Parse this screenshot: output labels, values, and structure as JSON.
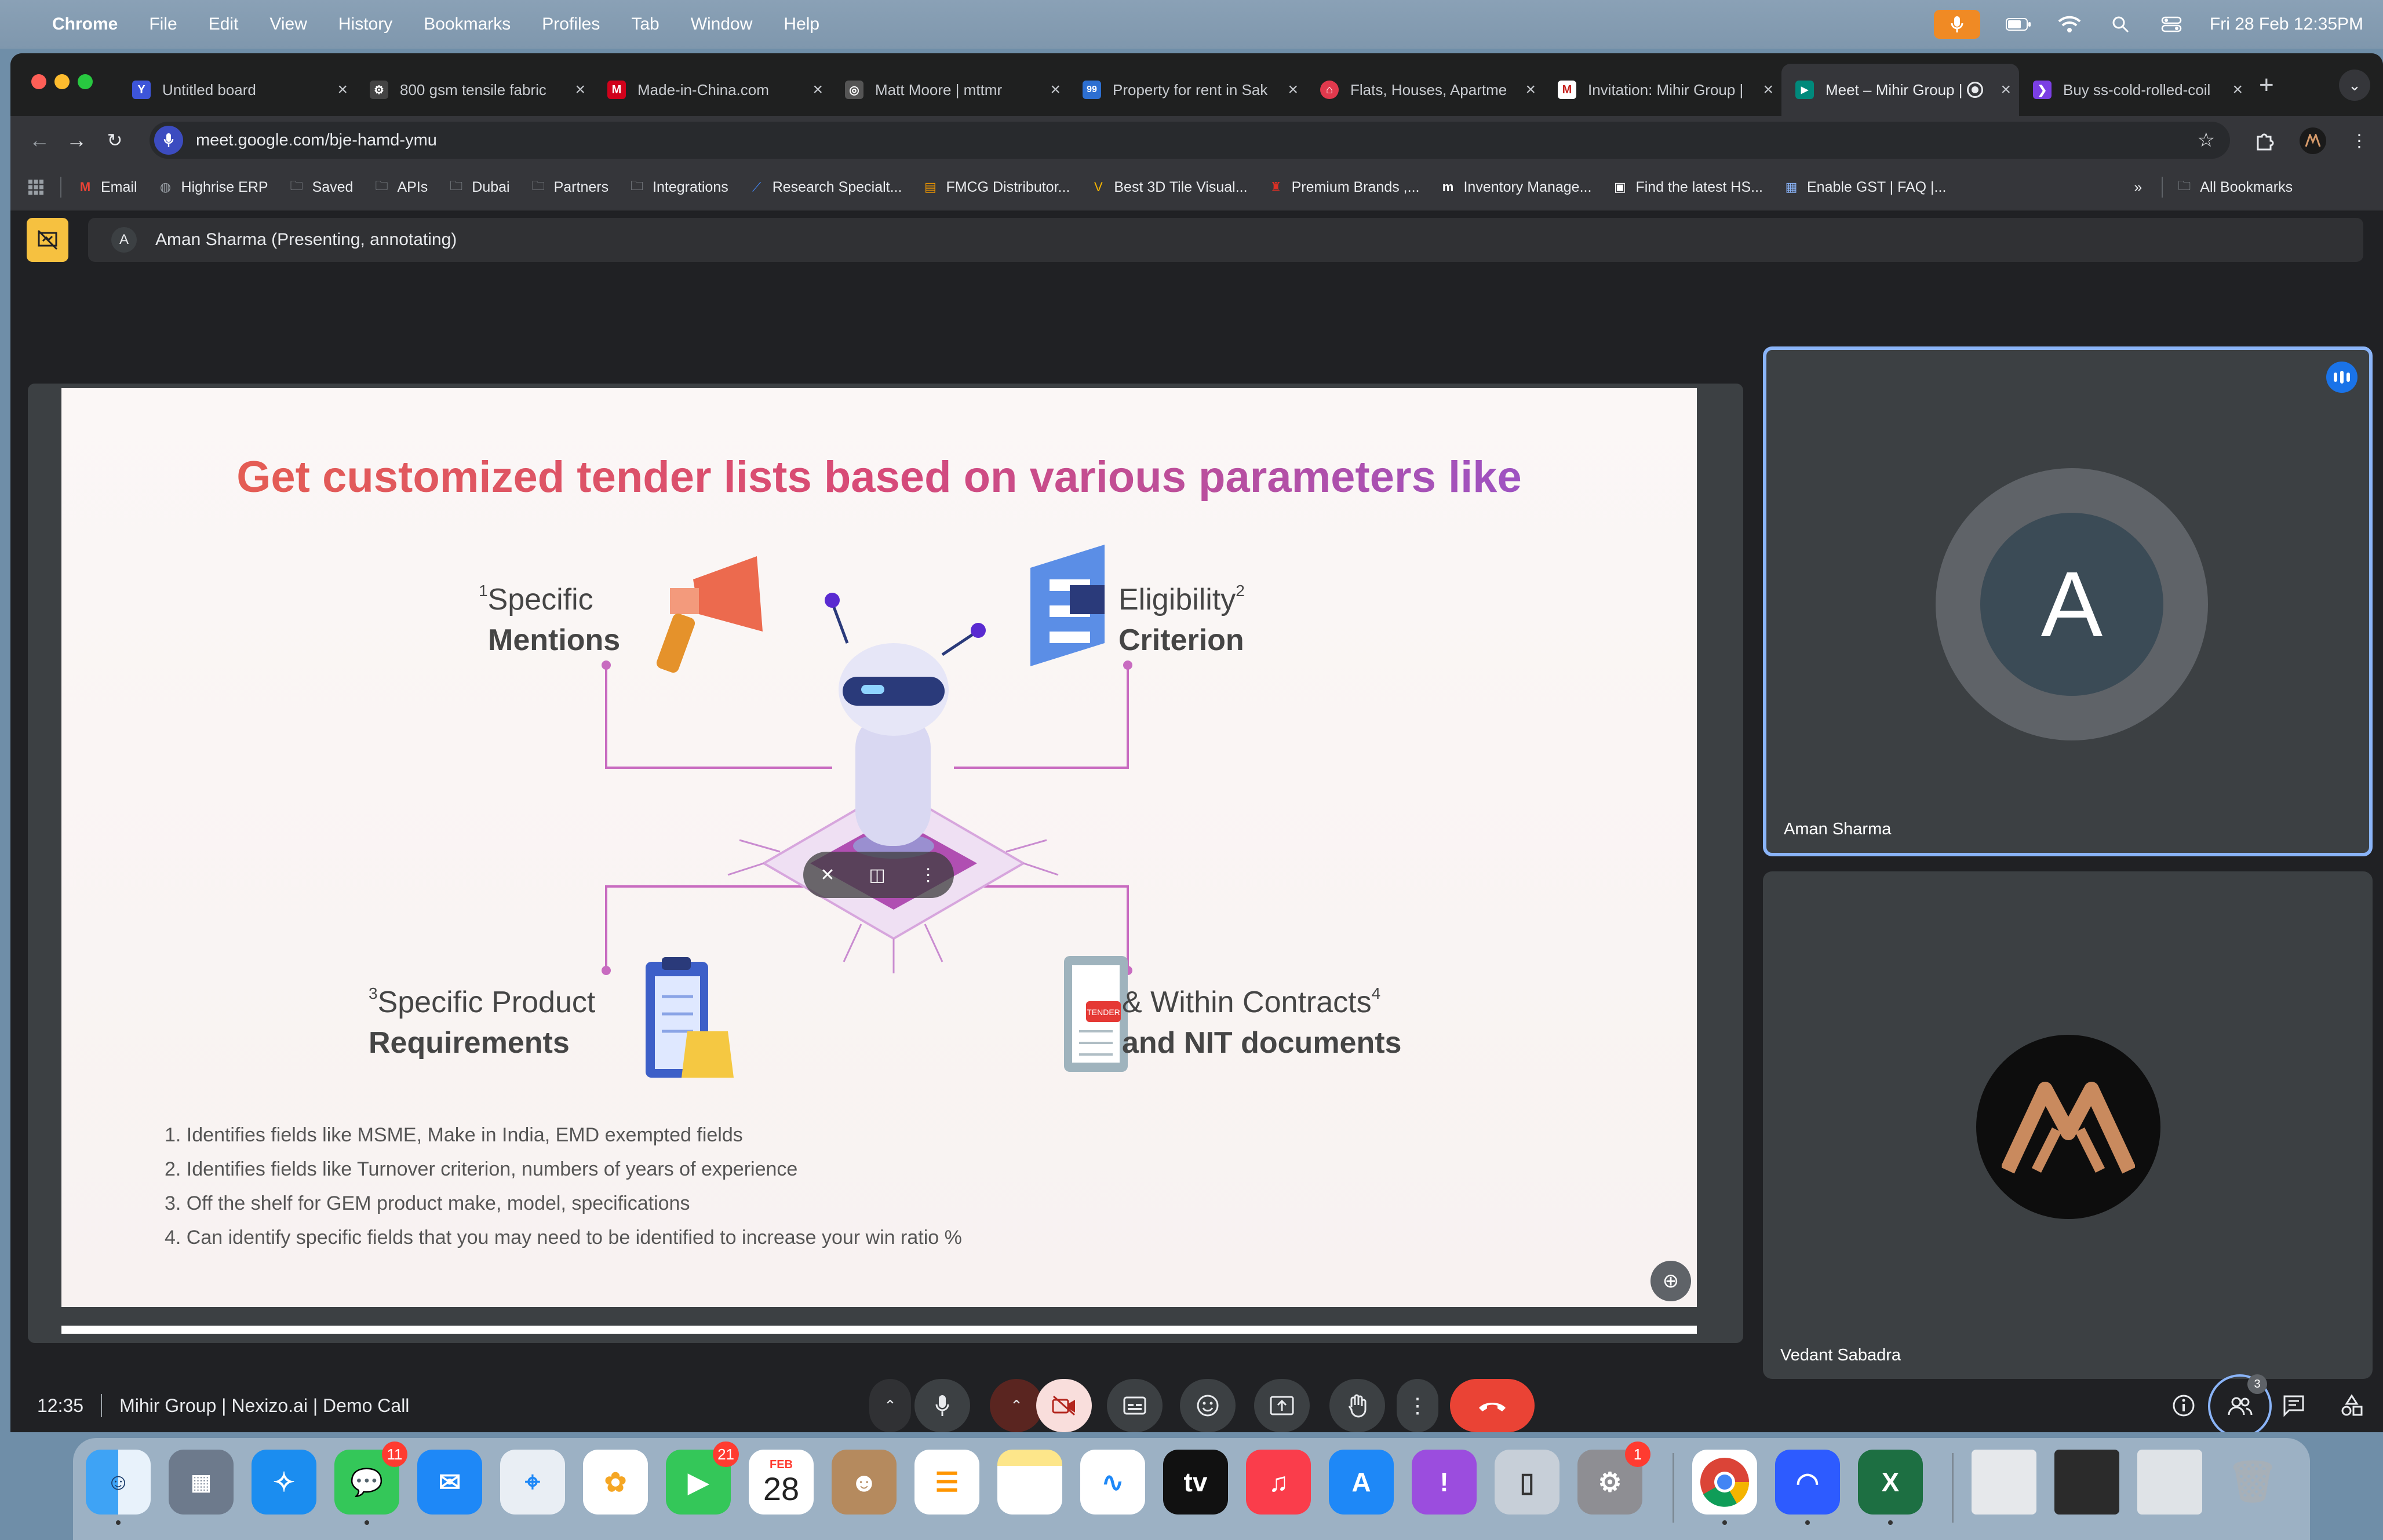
{
  "menubar": {
    "app": "Chrome",
    "menus": [
      "File",
      "Edit",
      "View",
      "History",
      "Bookmarks",
      "Profiles",
      "Tab",
      "Window",
      "Help"
    ],
    "datetime": "Fri 28 Feb  12:35PM"
  },
  "tabs": [
    {
      "title": "Untitled board",
      "favicon": "Y",
      "color": "#3d55d9"
    },
    {
      "title": "800 gsm tensile fabric",
      "favicon": "⚙",
      "color": "#444"
    },
    {
      "title": "Made-in-China.com",
      "favicon": "M",
      "color": "#d0021b"
    },
    {
      "title": "Matt Moore | mttmr",
      "favicon": "◎",
      "color": "#555"
    },
    {
      "title": "Property for rent in Sak",
      "favicon": "99",
      "color": "#2d6fd1"
    },
    {
      "title": "Flats, Houses, Apartme",
      "favicon": "⌂",
      "color": "#e0394d"
    },
    {
      "title": "Invitation: Mihir Group |",
      "favicon": "M",
      "color": "#c5221f"
    },
    {
      "title": "Meet – Mihir Group |",
      "favicon": "▶",
      "color": "#00897b",
      "active": true
    },
    {
      "title": "Buy ss-cold-rolled-coil",
      "favicon": "❯",
      "color": "#7b3fe4"
    }
  ],
  "address": {
    "url": "meet.google.com/bje-hamd-ymu"
  },
  "bookmarks": [
    {
      "label": "Email",
      "icon": "mail-icon"
    },
    {
      "label": "Highrise ERP",
      "icon": "globe-icon"
    },
    {
      "label": "Saved",
      "icon": "folder-icon"
    },
    {
      "label": "APIs",
      "icon": "folder-icon"
    },
    {
      "label": "Dubai",
      "icon": "folder-icon"
    },
    {
      "label": "Partners",
      "icon": "folder-icon"
    },
    {
      "label": "Integrations",
      "icon": "folder-icon"
    },
    {
      "label": "Research Specialt...",
      "icon": "link-icon"
    },
    {
      "label": "FMCG Distributor...",
      "icon": "link-icon"
    },
    {
      "label": "Best 3D Tile Visual...",
      "icon": "link-icon"
    },
    {
      "label": "Premium Brands ,...",
      "icon": "link-icon"
    },
    {
      "label": "Inventory Manage...",
      "icon": "link-icon"
    },
    {
      "label": "Find the latest HS...",
      "icon": "link-icon"
    },
    {
      "label": "Enable GST | FAQ |...",
      "icon": "link-icon"
    }
  ],
  "bookmarks_all": "All Bookmarks",
  "meet": {
    "presenter_bar": "Aman Sharma (Presenting, annotating)",
    "presenter_initial": "A",
    "slide": {
      "title": "Get customized tender lists based on various parameters like",
      "params": [
        {
          "sup": "1",
          "line1": "Specific",
          "line2": "Mentions"
        },
        {
          "sup": "2",
          "line1": "Eligibility",
          "line2": "Criterion"
        },
        {
          "sup": "3",
          "line1": "Specific Product",
          "line2": "Requirements"
        },
        {
          "sup": "4",
          "line1": "& Within Contracts",
          "line2": "and NIT documents"
        }
      ],
      "notes": [
        "1. Identifies fields like MSME, Make in India, EMD exempted fields",
        "2. Identifies fields like Turnover criterion, numbers of years of experience",
        "3. Off the shelf for GEM product make, model, specifications",
        "4. Can identify specific fields that you may need to be identified to increase your win ratio %"
      ],
      "doc_stamp": "TENDER"
    },
    "participants": [
      {
        "name": "Aman Sharma",
        "initial": "A"
      },
      {
        "name": "Vedant Sabadra"
      }
    ],
    "time": "12:35",
    "meeting_title": "Mihir Group | Nexizo.ai | Demo Call",
    "people_count": "3"
  },
  "dock": {
    "badges": {
      "messages": "11",
      "facetime": "21",
      "settings": "1"
    },
    "calendar": {
      "month": "FEB",
      "day": "28"
    }
  }
}
